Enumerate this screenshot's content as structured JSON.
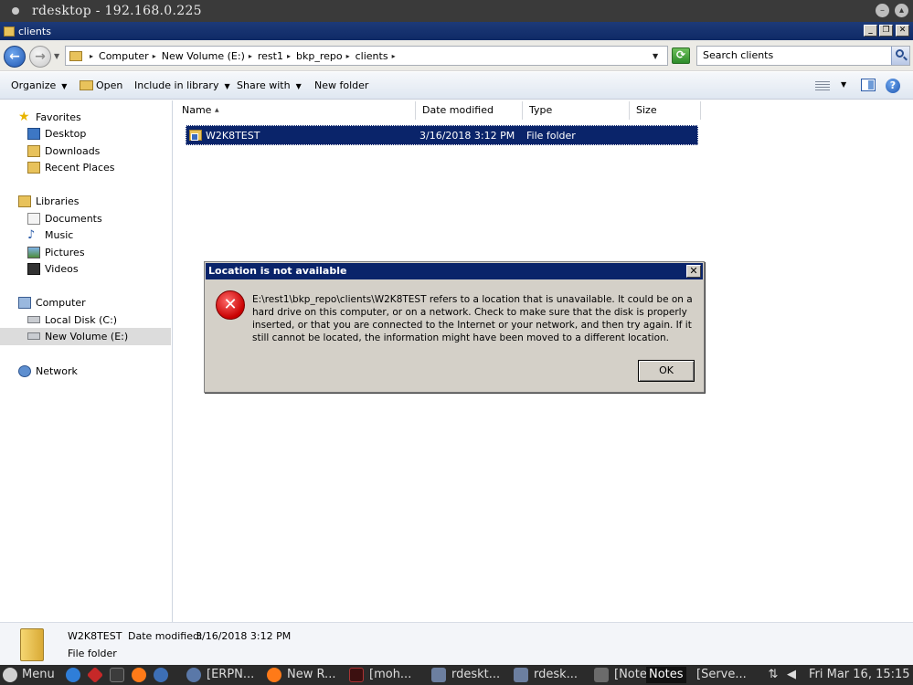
{
  "outer_window": {
    "title": "rdesktop - 192.168.0.225"
  },
  "explorer": {
    "title": "clients",
    "breadcrumb": [
      "Computer",
      "New Volume (E:)",
      "rest1",
      "bkp_repo",
      "clients"
    ],
    "search_placeholder": "Search clients",
    "toolbar": {
      "organize": "Organize",
      "open": "Open",
      "include_in_library": "Include in library",
      "share_with": "Share with",
      "new_folder": "New folder"
    },
    "nav": {
      "favorites": "Favorites",
      "desktop": "Desktop",
      "downloads": "Downloads",
      "recent_places": "Recent Places",
      "libraries": "Libraries",
      "documents": "Documents",
      "music": "Music",
      "pictures": "Pictures",
      "videos": "Videos",
      "computer": "Computer",
      "local_disk": "Local Disk (C:)",
      "new_volume": "New Volume (E:)",
      "network": "Network"
    },
    "columns": {
      "name": "Name",
      "date_modified": "Date modified",
      "type": "Type",
      "size": "Size"
    },
    "files": [
      {
        "name": "W2K8TEST",
        "date_modified": "3/16/2018 3:12 PM",
        "type": "File folder",
        "size": ""
      }
    ],
    "details": {
      "name": "W2K8TEST",
      "date_label": "Date modified:",
      "date_value": "3/16/2018 3:12 PM",
      "type": "File folder"
    }
  },
  "dialog": {
    "title": "Location is not available",
    "message": "E:\\rest1\\bkp_repo\\clients\\W2K8TEST refers to a location that is unavailable. It could be on a hard drive on this computer, or on a network. Check to make sure that the disk is properly inserted, or that you are connected to the Internet or your network, and then try again. If it still cannot be located, the information might have been moved to a different location.",
    "ok_label": "OK"
  },
  "taskbar": {
    "menu": "Menu",
    "tasks": [
      "[ERPN...",
      "New R...",
      "[moh...",
      "rdeskt...",
      "rdesk...",
      "[Note",
      "Notes",
      "[Serve..."
    ],
    "clock": "Fri Mar 16, 15:15"
  },
  "colors": {
    "selection": "#0a246a",
    "dialog_face": "#d4d0c8",
    "taskbar": "#2b2b2b"
  }
}
